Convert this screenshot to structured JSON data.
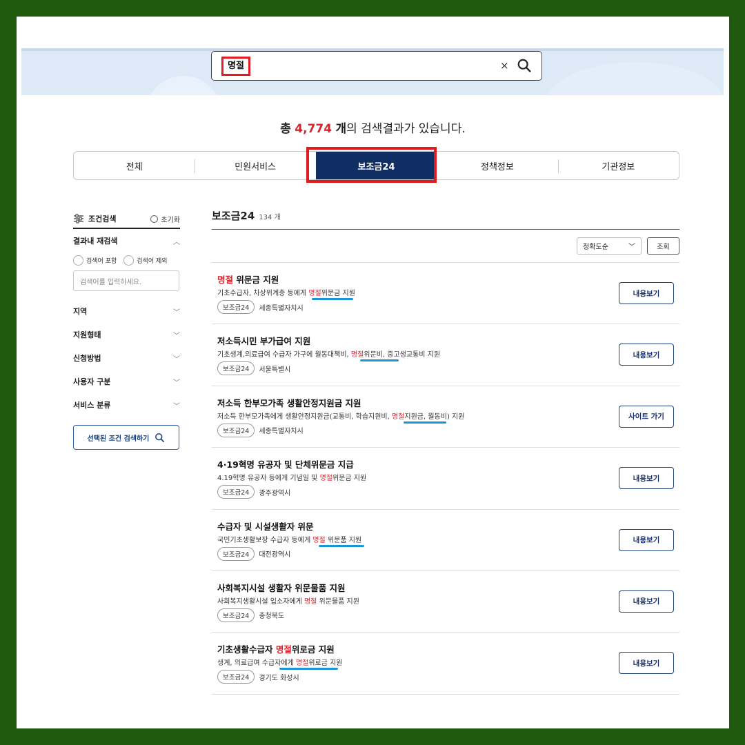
{
  "search": {
    "query": "명절",
    "clear_icon": "×"
  },
  "summary": {
    "prefix": "총",
    "count": "4,774",
    "unit": "개",
    "suffix": "의 검색결과가 있습니다."
  },
  "tabs": [
    {
      "label": "전체"
    },
    {
      "label": "민원서비스"
    },
    {
      "label": "보조금24",
      "active": true
    },
    {
      "label": "정책정보"
    },
    {
      "label": "기관정보"
    }
  ],
  "sidebar": {
    "title": "조건검색",
    "reset": "초기화",
    "refine_label": "결과내 재검색",
    "include_label": "검색어 포함",
    "exclude_label": "검색어 제외",
    "keyword_placeholder": "검색어를 입력하세요.",
    "filters": [
      "지역",
      "지원형태",
      "신청방법",
      "사용자 구분",
      "서비스 분류"
    ],
    "apply_label": "선택된 조건 검색하기"
  },
  "results_header": {
    "title": "보조금24",
    "count": "134 개"
  },
  "sort": {
    "selected": "정확도순",
    "submit_label": "조회"
  },
  "results": [
    {
      "title_pre": "",
      "title_hl": "명절",
      "title_post": " 위문금 지원",
      "desc_pre": "기초수급자, 차상위계층 등에게 ",
      "desc_hl": "명절",
      "desc_post": "위문금 지원",
      "tag": "보조금24",
      "org": "세종특별자치시",
      "action": "내용보기"
    },
    {
      "title_pre": "저소득시민 부가급여 지원",
      "title_hl": "",
      "title_post": "",
      "desc_pre": "기초생계,의료급여 수급자 가구에 월동대책비, ",
      "desc_hl": "명절",
      "desc_post": "위문비, 중고생교통비 지원",
      "tag": "보조금24",
      "org": "서울특별시",
      "action": "내용보기"
    },
    {
      "title_pre": "저소득 한부모가족 생활안정지원금 지원",
      "title_hl": "",
      "title_post": "",
      "desc_pre": "저소득 한부모가족에게 생활안정지원금(교통비, 학습지원비, ",
      "desc_hl": "명절",
      "desc_post": "지원금, 월동비) 지원",
      "tag": "보조금24",
      "org": "세종특별자치시",
      "action": "사이트 가기"
    },
    {
      "title_pre": "4·19혁명 유공자 및 단체위문금 지급",
      "title_hl": "",
      "title_post": "",
      "desc_pre": "4.19혁명 유공자 등에게 기념일 및 ",
      "desc_hl": "명절",
      "desc_post": "위문금 지원",
      "tag": "보조금24",
      "org": "광주광역시",
      "action": "내용보기"
    },
    {
      "title_pre": "수급자 및 시설생활자 위문",
      "title_hl": "",
      "title_post": "",
      "desc_pre": "국민기초생활보장 수급자 등에게 ",
      "desc_hl": "명절",
      "desc_post": " 위문품 지원",
      "tag": "보조금24",
      "org": "대전광역시",
      "action": "내용보기"
    },
    {
      "title_pre": "사회복지시설 생활자 위문물품 지원",
      "title_hl": "",
      "title_post": "",
      "desc_pre": "사회복지생활시설 입소자에게 ",
      "desc_hl": "명절",
      "desc_post": " 위문물품 지원",
      "tag": "보조금24",
      "org": "충청북도",
      "action": "내용보기"
    },
    {
      "title_pre": "기초생활수급자 ",
      "title_hl": "명절",
      "title_post": "위로금 지원",
      "desc_pre": "생계, 의료급여 수급자에게 ",
      "desc_hl": "명절",
      "desc_post": "위로금 지원",
      "tag": "보조금24",
      "org": "경기도 화성시",
      "action": "내용보기"
    }
  ]
}
